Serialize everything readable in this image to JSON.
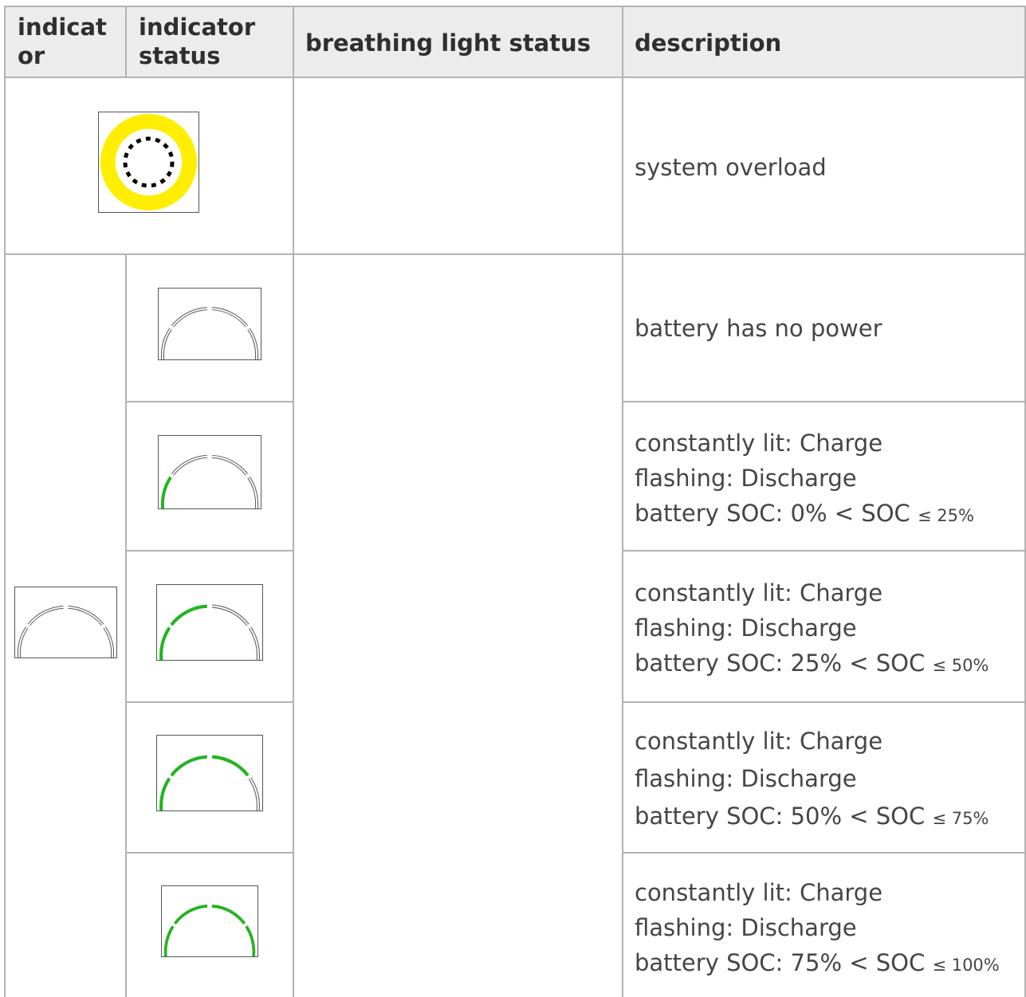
{
  "table": {
    "headers": {
      "indicator_line1": "indicat",
      "indicator_line2": "or",
      "indicator_status_line1": "indicator",
      "indicator_status_line2": "status",
      "breathing_light_status": "breathing light status",
      "description": "description"
    },
    "rows": [
      {
        "description_lines": [
          "system overload"
        ],
        "indicator_icon": "yellow-ring-dotted-icon"
      },
      {
        "description_lines": [
          "battery has no power"
        ],
        "status_icon": "battery-arc-0-of-4-icon",
        "lit_segments": 0
      },
      {
        "description_lines": [
          "constantly lit: Charge",
          "flashing: Discharge",
          "battery SOC: 0% < SOC "
        ],
        "cond_small": "≤ 25%",
        "status_icon": "battery-arc-1-of-4-icon",
        "lit_segments": 1
      },
      {
        "description_lines": [
          "constantly lit: Charge",
          "flashing: Discharge",
          "battery SOC: 25% < SOC "
        ],
        "cond_small": "≤ 50%",
        "status_icon": "battery-arc-2-of-4-icon",
        "lit_segments": 2
      },
      {
        "description_lines": [
          "constantly lit: Charge",
          "flashing: Discharge",
          "battery SOC: 50% < SOC "
        ],
        "cond_small": "≤ 75%",
        "status_icon": "battery-arc-3-of-4-icon",
        "lit_segments": 3
      },
      {
        "description_lines": [
          "constantly lit: Charge",
          "flashing: Discharge",
          "battery SOC: 75% < SOC "
        ],
        "cond_small": "≤ 100%",
        "status_icon": "battery-arc-4-of-4-icon",
        "lit_segments": 4
      }
    ],
    "battery_indicator_icon": "battery-arc-outline-icon"
  },
  "colors": {
    "header_bg": "#ececec",
    "border": "#b3b3b3",
    "lit_green": "#22b41e",
    "ring_yellow": "#ffee00"
  }
}
